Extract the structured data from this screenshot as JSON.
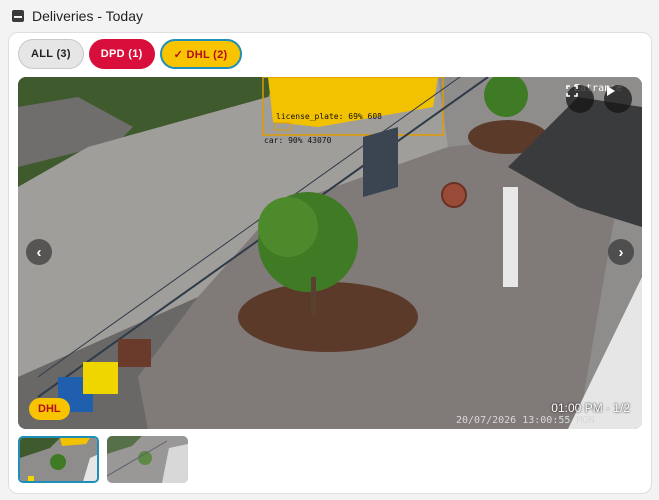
{
  "header": {
    "icon": "dashboard-icon",
    "title": "Deliveries - Today"
  },
  "filters": [
    {
      "label": "ALL (3)",
      "selected": false,
      "color": "#e6e6e6"
    },
    {
      "label": "DPD (1)",
      "selected": false,
      "color": "#d80f3a"
    },
    {
      "label": "✓ DHL (2)",
      "selected": true,
      "color": "#f8c400"
    }
  ],
  "viewer": {
    "detections": [
      {
        "label": "license_plate: 69% 608"
      },
      {
        "label": "car: 90% 43070"
      }
    ],
    "camera_overlay_text": "Eatrance",
    "camera_timestamp": "20/07/2026 13:00:55 MON",
    "carrier_badge": "DHL",
    "time_counter": "01:00 PM · 1/2",
    "controls": {
      "fullscreen_icon": "fullscreen-icon",
      "play_icon": "play-icon",
      "prev_icon": "chevron-left-icon",
      "next_icon": "chevron-right-icon"
    }
  },
  "thumbnails": [
    {
      "selected": true
    },
    {
      "selected": false
    }
  ],
  "colors": {
    "dhl_yellow": "#f8c400",
    "dpd_red": "#d80f3a",
    "selection_blue": "#1f8fb8"
  }
}
